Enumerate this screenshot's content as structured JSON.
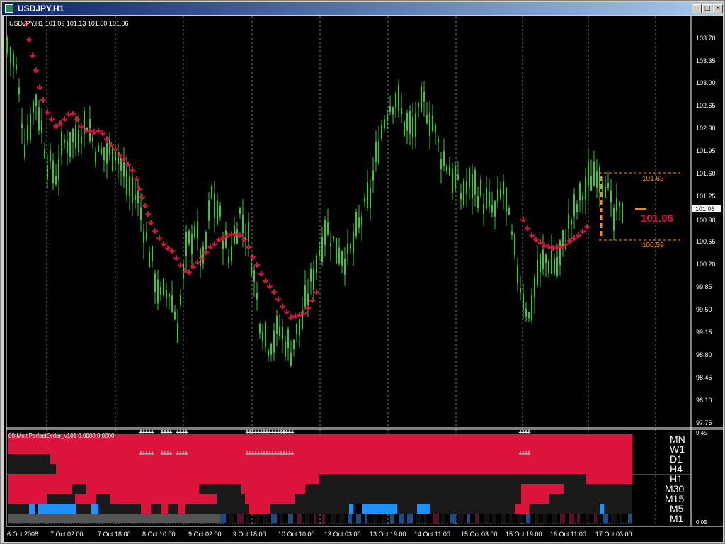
{
  "window": {
    "title": "USDJPY,H1",
    "buttons": {
      "minimize": "_",
      "maximize": "□",
      "close": "×"
    }
  },
  "chart": {
    "header": "USDJPY,H1  101.09 101.13 101.00 101.06",
    "price_axis": [
      "103.70",
      "103.35",
      "103.00",
      "102.65",
      "102.30",
      "101.95",
      "101.60",
      "101.25",
      "100.90",
      "100.55",
      "100.20",
      "99.85",
      "99.50",
      "99.15",
      "98.80",
      "98.45",
      "98.10",
      "97.75"
    ],
    "current_price_tag": "101.06",
    "big_price_label": "101.06",
    "range_high_label": "101.62",
    "range_low_label": "100.59",
    "time_axis": [
      "6 Oct 2008",
      "7 Oct 02:00",
      "7 Oct 18:00",
      "8 Oct 10:00",
      "9 Oct 02:00",
      "9 Oct 18:00",
      "10 Oct 10:00",
      "13 Oct 03:00",
      "13 Oct 19:00",
      "14 Oct 11:00",
      "15 Oct 03:00",
      "15 Oct 19:00",
      "16 Oct 11:00",
      "17 Oct 03:00"
    ],
    "colors": {
      "candle": "#33cc33",
      "arrow": "#dc143c",
      "background": "#000000",
      "grid": "#ffffff",
      "range": "#ff8c00",
      "up_bar": "#dc143c",
      "neutral_bar": "#1a1a1a",
      "blue_bar": "#1e90ff"
    }
  },
  "indicator": {
    "header": "00-MultiPerfectOrder_v101 9.0000 0.0000",
    "scale_top": "9.45",
    "scale_bottom": "0.05",
    "timeframes": [
      "MN",
      "W1",
      "D1",
      "H4",
      "H1",
      "M30",
      "M15",
      "M5",
      "M1"
    ]
  },
  "chart_data": {
    "type": "candlestick",
    "symbol": "USDJPY",
    "timeframe": "H1",
    "last_bar": {
      "open": 101.09,
      "high": 101.13,
      "low": 101.0,
      "close": 101.06
    },
    "ylim": [
      97.6,
      103.95
    ],
    "path_points": [
      {
        "x": 0,
        "y": 103.6
      },
      {
        "x": 3,
        "y": 103.2
      },
      {
        "x": 6,
        "y": 102.1
      },
      {
        "x": 10,
        "y": 102.8
      },
      {
        "x": 14,
        "y": 101.8
      },
      {
        "x": 17,
        "y": 101.6
      },
      {
        "x": 20,
        "y": 102.1
      },
      {
        "x": 24,
        "y": 102.2
      },
      {
        "x": 28,
        "y": 102.4
      },
      {
        "x": 32,
        "y": 101.9
      },
      {
        "x": 38,
        "y": 102.0
      },
      {
        "x": 42,
        "y": 101.5
      },
      {
        "x": 46,
        "y": 101.2
      },
      {
        "x": 50,
        "y": 100.4
      },
      {
        "x": 54,
        "y": 99.7
      },
      {
        "x": 57,
        "y": 99.8
      },
      {
        "x": 60,
        "y": 99.3
      },
      {
        "x": 63,
        "y": 100.4
      },
      {
        "x": 66,
        "y": 100.8
      },
      {
        "x": 69,
        "y": 100.2
      },
      {
        "x": 72,
        "y": 101.3
      },
      {
        "x": 75,
        "y": 100.9
      },
      {
        "x": 78,
        "y": 100.3
      },
      {
        "x": 82,
        "y": 101.0
      },
      {
        "x": 85,
        "y": 100.6
      },
      {
        "x": 89,
        "y": 99.4
      },
      {
        "x": 92,
        "y": 99.0
      },
      {
        "x": 96,
        "y": 99.2
      },
      {
        "x": 100,
        "y": 98.9
      },
      {
        "x": 104,
        "y": 99.4
      },
      {
        "x": 108,
        "y": 100.1
      },
      {
        "x": 112,
        "y": 100.8
      },
      {
        "x": 116,
        "y": 100.5
      },
      {
        "x": 120,
        "y": 100.3
      },
      {
        "x": 124,
        "y": 100.8
      },
      {
        "x": 128,
        "y": 101.3
      },
      {
        "x": 131,
        "y": 102.1
      },
      {
        "x": 134,
        "y": 102.6
      },
      {
        "x": 137,
        "y": 102.8
      },
      {
        "x": 140,
        "y": 102.4
      },
      {
        "x": 143,
        "y": 102.3
      },
      {
        "x": 147,
        "y": 102.7
      },
      {
        "x": 150,
        "y": 102.4
      },
      {
        "x": 153,
        "y": 101.9
      },
      {
        "x": 156,
        "y": 101.7
      },
      {
        "x": 160,
        "y": 101.3
      },
      {
        "x": 164,
        "y": 101.5
      },
      {
        "x": 168,
        "y": 101.2
      },
      {
        "x": 172,
        "y": 101.0
      },
      {
        "x": 175,
        "y": 101.4
      },
      {
        "x": 178,
        "y": 100.6
      },
      {
        "x": 181,
        "y": 99.9
      },
      {
        "x": 184,
        "y": 99.4
      },
      {
        "x": 187,
        "y": 100.1
      },
      {
        "x": 190,
        "y": 100.3
      },
      {
        "x": 194,
        "y": 100.2
      },
      {
        "x": 198,
        "y": 100.8
      },
      {
        "x": 202,
        "y": 101.2
      },
      {
        "x": 205,
        "y": 101.5
      },
      {
        "x": 208,
        "y": 101.7
      },
      {
        "x": 211,
        "y": 101.5
      },
      {
        "x": 214,
        "y": 100.9
      },
      {
        "x": 217,
        "y": 101.1
      }
    ]
  }
}
